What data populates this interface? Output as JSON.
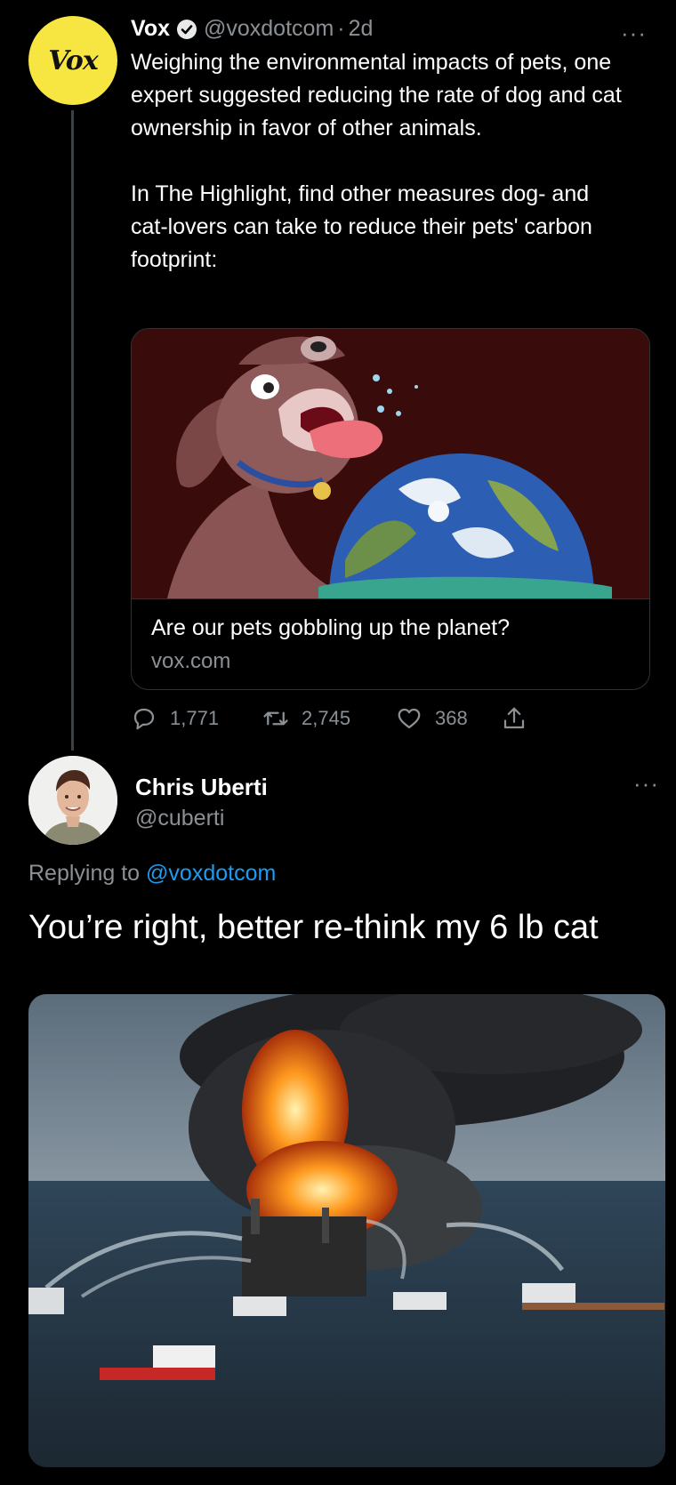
{
  "tweet": {
    "avatar_text": "Vox",
    "name": "Vox",
    "handle": "@voxdotcom",
    "separator": "·",
    "time": "2d",
    "text_p1": "Weighing the environmental impacts of pets, one expert suggested reducing the rate of dog and cat ownership in favor of other animals.",
    "text_p2": "In The Highlight, find other measures dog- and cat-lovers can take to reduce their pets' carbon footprint:",
    "more": "···",
    "card": {
      "title": "Are our pets gobbling up the planet?",
      "domain": "vox.com"
    },
    "stats": {
      "replies": "1,771",
      "retweets": "2,745",
      "likes": "368"
    }
  },
  "reply": {
    "name": "Chris Uberti",
    "handle": "@cuberti",
    "more": "···",
    "replying_prefix": "Replying to ",
    "replying_handle": "@voxdotcom",
    "text": "You’re right, better re-think my 6 lb cat"
  },
  "icons": {
    "verified": "verified-badge-icon",
    "reply": "reply-icon",
    "retweet": "retweet-icon",
    "like": "heart-icon",
    "share": "share-icon",
    "more": "more-icon"
  },
  "colors": {
    "background": "#000000",
    "accent": "#1d9bf0",
    "muted": "#8b9095",
    "vox_yellow": "#f7e642"
  }
}
